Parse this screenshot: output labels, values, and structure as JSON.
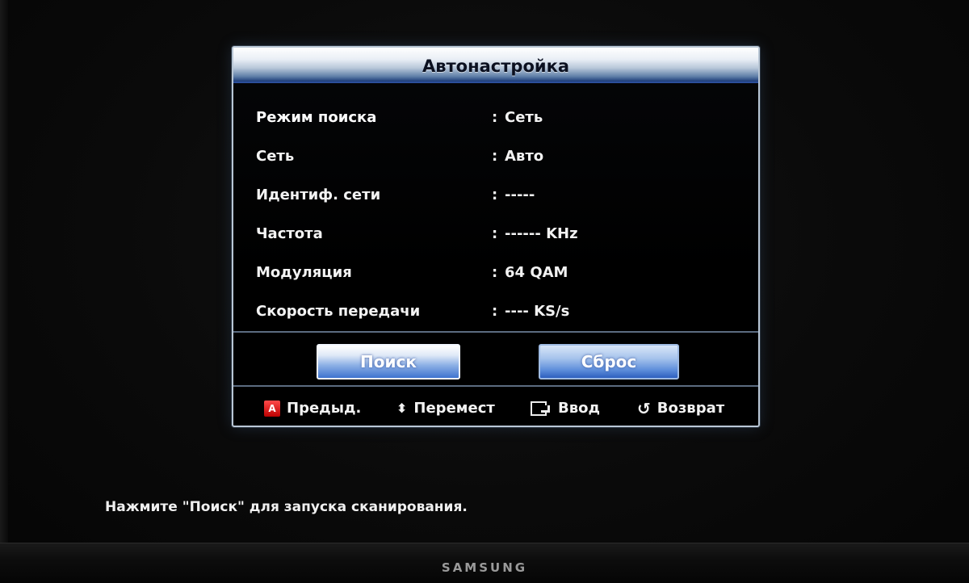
{
  "dialog": {
    "title": "Автонастройка",
    "rows": [
      {
        "label": "Режим поиска",
        "value": "Сеть"
      },
      {
        "label": "Сеть",
        "value": "Авто"
      },
      {
        "label": "Идентиф. сети",
        "value": "-----"
      },
      {
        "label": "Частота",
        "value": "------ KHz"
      },
      {
        "label": "Модуляция",
        "value": "64 QAM"
      },
      {
        "label": "Скорость передачи",
        "value": "---- KS/s"
      }
    ],
    "buttons": {
      "search": "Поиск",
      "reset": "Сброс"
    },
    "footer": {
      "prev": {
        "icon": "red-a-button-icon",
        "label": "Предыд."
      },
      "move": {
        "icon": "up-down-arrows-icon",
        "label": "Перемест"
      },
      "enter": {
        "icon": "enter-icon",
        "label": "Ввод"
      },
      "back": {
        "icon": "return-icon",
        "label": "Возврат"
      }
    }
  },
  "hint": "Нажмите \"Поиск\" для запуска сканирования.",
  "brand": "SAMSUNG",
  "colors": {
    "accent_blue": "#3f73cf",
    "title_bar": "#1a3a78",
    "red_key": "#e02020"
  }
}
